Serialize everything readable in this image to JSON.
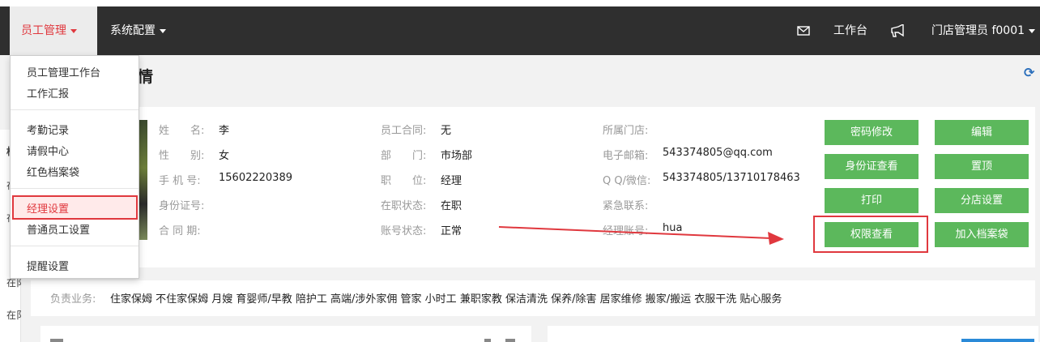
{
  "nav": {
    "employee_mgmt": "员工管理",
    "system_config": "系统配置",
    "workbench": "工作台",
    "user": "门店管理员",
    "user_id": "f0001"
  },
  "page": {
    "title_fragment": "情"
  },
  "dropdown": {
    "items": [
      "员工管理工作台",
      "工作汇报",
      "考勤记录",
      "请假中心",
      "红色档案袋",
      "经理设置",
      "普通员工设置",
      "提醒设置"
    ]
  },
  "left_strip": [
    "档",
    "在",
    "在",
    "在阝",
    "在阝"
  ],
  "profile": {
    "col1": [
      {
        "label": "姓　　名:",
        "value": "李"
      },
      {
        "label": "性　　别:",
        "value": "女"
      },
      {
        "label": "手 机 号:",
        "value": "15602220389"
      },
      {
        "label": "身份证号:",
        "value": ""
      },
      {
        "label": "合 同 期:",
        "value": ""
      }
    ],
    "col2": [
      {
        "label": "员工合同:",
        "value": "无"
      },
      {
        "label": "部　　门:",
        "value": "市场部"
      },
      {
        "label": "职　　位:",
        "value": "经理"
      },
      {
        "label": "在职状态:",
        "value": "在职"
      },
      {
        "label": "账号状态:",
        "value": "正常"
      }
    ],
    "col3": [
      {
        "label": "所属门店:",
        "value": ""
      },
      {
        "label": "电子邮箱:",
        "value": "543374805@qq.com"
      },
      {
        "label": "Q Q/微信:",
        "value": "543374805/13710178463"
      },
      {
        "label": "紧急联系:",
        "value": ""
      },
      {
        "label": "经理账号:",
        "value": "hua"
      }
    ]
  },
  "buttons": {
    "left": [
      "密码修改",
      "身份证查看",
      "打印",
      "权限查看"
    ],
    "right": [
      "编辑",
      "置顶",
      "分店设置",
      "加入档案袋"
    ]
  },
  "business": {
    "label": "负责业务:",
    "items": "住家保姆 不住家保姆 月嫂 育婴师/早教 陪护工 高端/涉外家佣 管家 小时工 兼职家教 保洁清洗 保养/除害 居家维修 搬家/搬运 衣服干洗 贴心服务"
  },
  "colors": {
    "accent_red": "#e0383e",
    "button_green": "#5cb85c",
    "topbar": "#2f2f2f"
  }
}
